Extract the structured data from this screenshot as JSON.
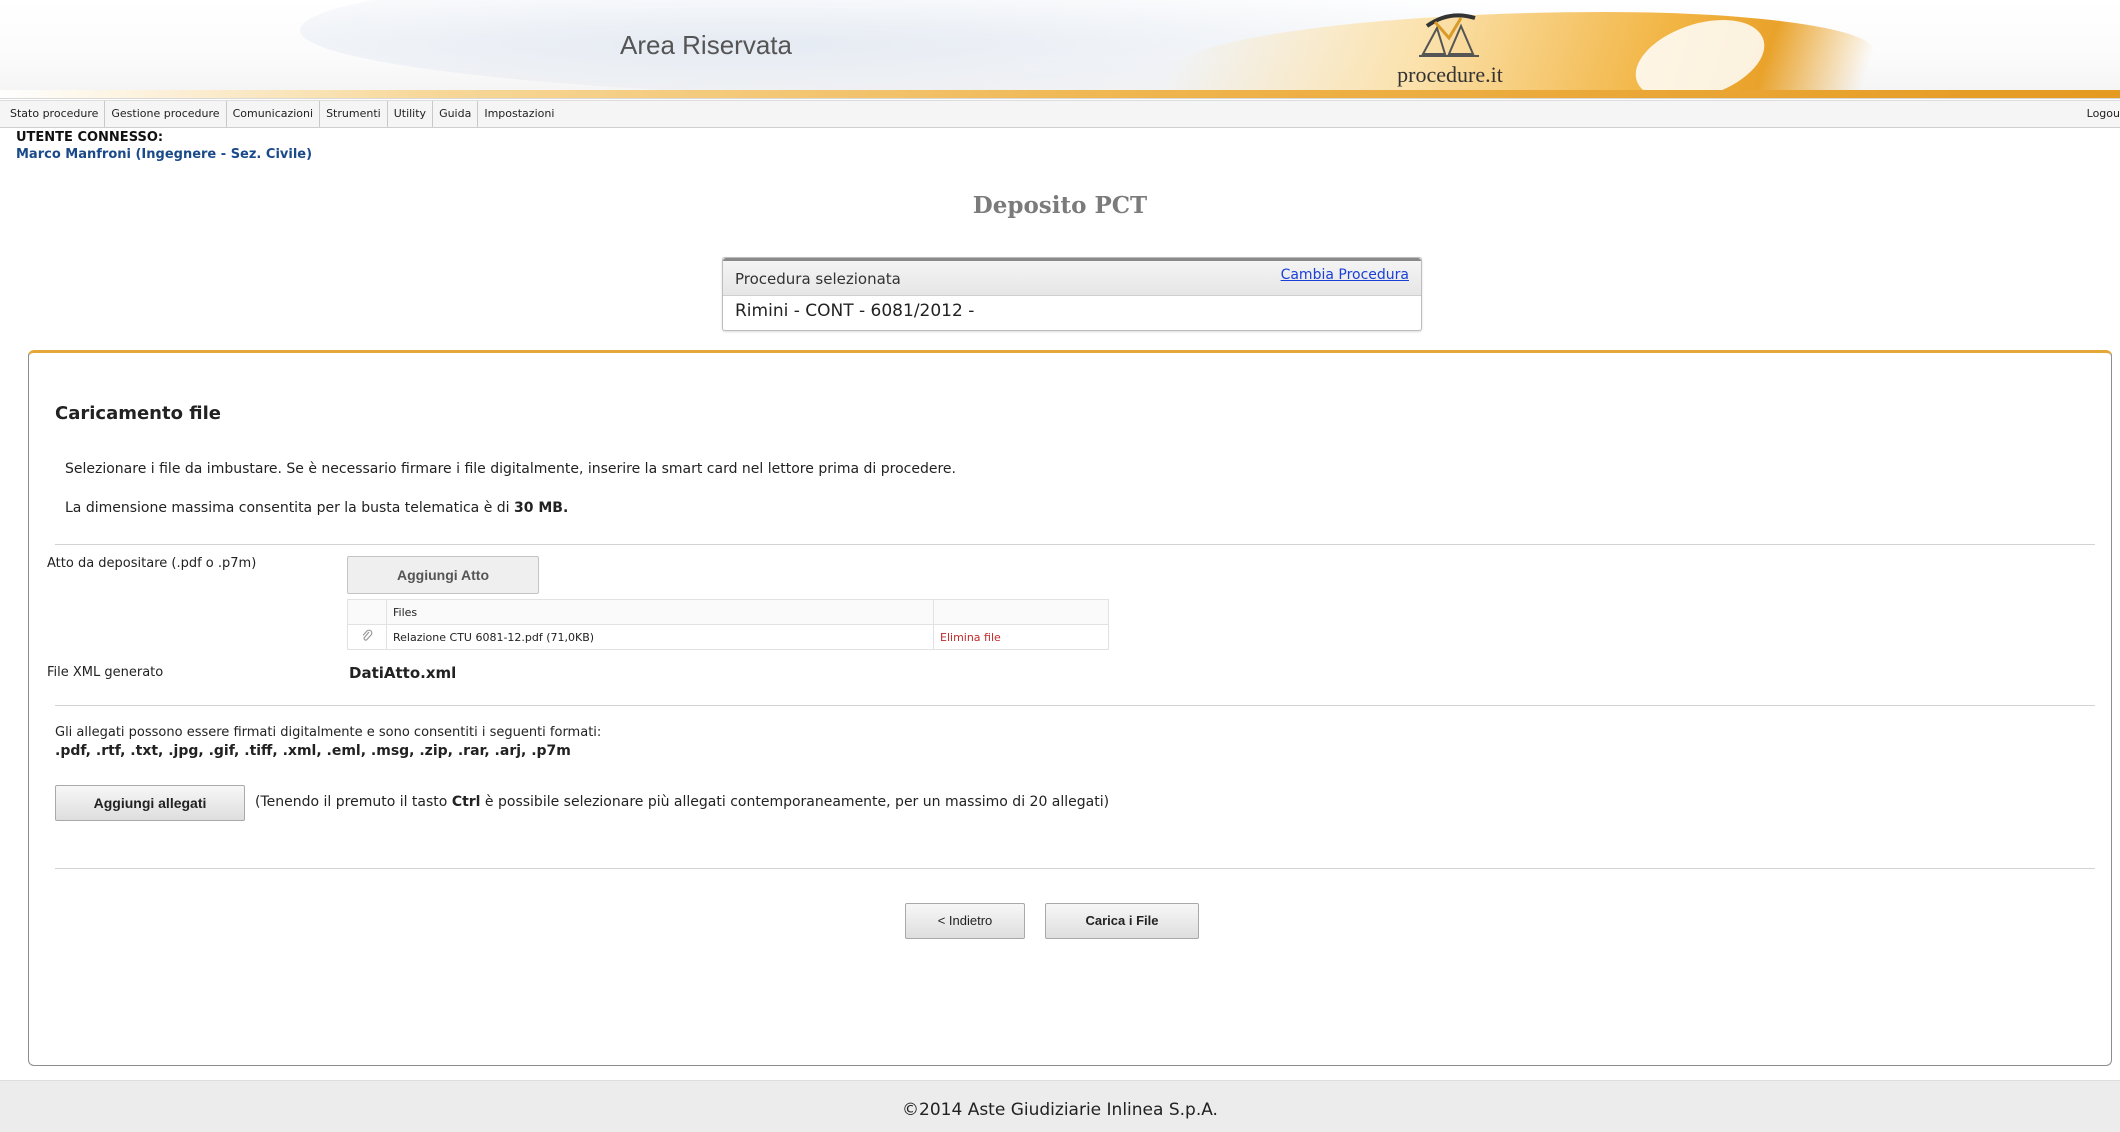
{
  "header": {
    "area_title": "Area Riservata",
    "logo_text": "procedure.it",
    "accent_color": "#e9a22a"
  },
  "menu": {
    "items": [
      {
        "label": "Stato procedure"
      },
      {
        "label": "Gestione procedure"
      },
      {
        "label": "Comunicazioni"
      },
      {
        "label": "Strumenti"
      },
      {
        "label": "Utility"
      },
      {
        "label": "Guida"
      },
      {
        "label": "Impostazioni"
      }
    ],
    "logout": "Logou"
  },
  "user": {
    "label": "UTENTE CONNESSO:",
    "name": "Marco Manfroni (Ingegnere - Sez. Civile)"
  },
  "page": {
    "title": "Deposito PCT"
  },
  "procedure_box": {
    "header": "Procedura selezionata",
    "change_link": "Cambia Procedura",
    "value": "Rimini - CONT - 6081/2012 -"
  },
  "upload": {
    "title": "Caricamento file",
    "instruction_1": "Selezionare i file da imbustare. Se è necessario firmare i file digitalmente, inserire la smart card nel lettore prima di procedere.",
    "instruction_2_prefix": "La dimensione massima consentita per la busta telematica è di ",
    "instruction_2_bold": "30 MB.",
    "atto_label": "Atto da depositare (.pdf o .p7m)",
    "add_atto_button": "Aggiungi Atto",
    "files_header": "Files",
    "files": [
      {
        "name": "Relazione CTU 6081-12.pdf (71,0KB)",
        "action": "Elimina file",
        "icon": "paperclip-icon"
      }
    ],
    "xml_label": "File XML generato",
    "xml_value": "DatiAtto.xml"
  },
  "attachments": {
    "info_line": "Gli allegati possono essere firmati digitalmente e sono consentiti i seguenti formati:",
    "formats": ".pdf, .rtf, .txt, .jpg, .gif, .tiff, .xml, .eml, .msg, .zip, .rar, .arj, .p7m",
    "add_button": "Aggiungi allegati",
    "note_prefix": "(Tenendo il premuto il tasto ",
    "note_bold": "Ctrl",
    "note_suffix": " è possibile selezionare più allegati contemporaneamente, per un massimo di 20 allegati)"
  },
  "actions": {
    "back_button": "< Indietro",
    "upload_button": "Carica i File"
  },
  "footer": {
    "copyright": "©2014 Aste Giudiziarie Inlinea S.p.A."
  }
}
